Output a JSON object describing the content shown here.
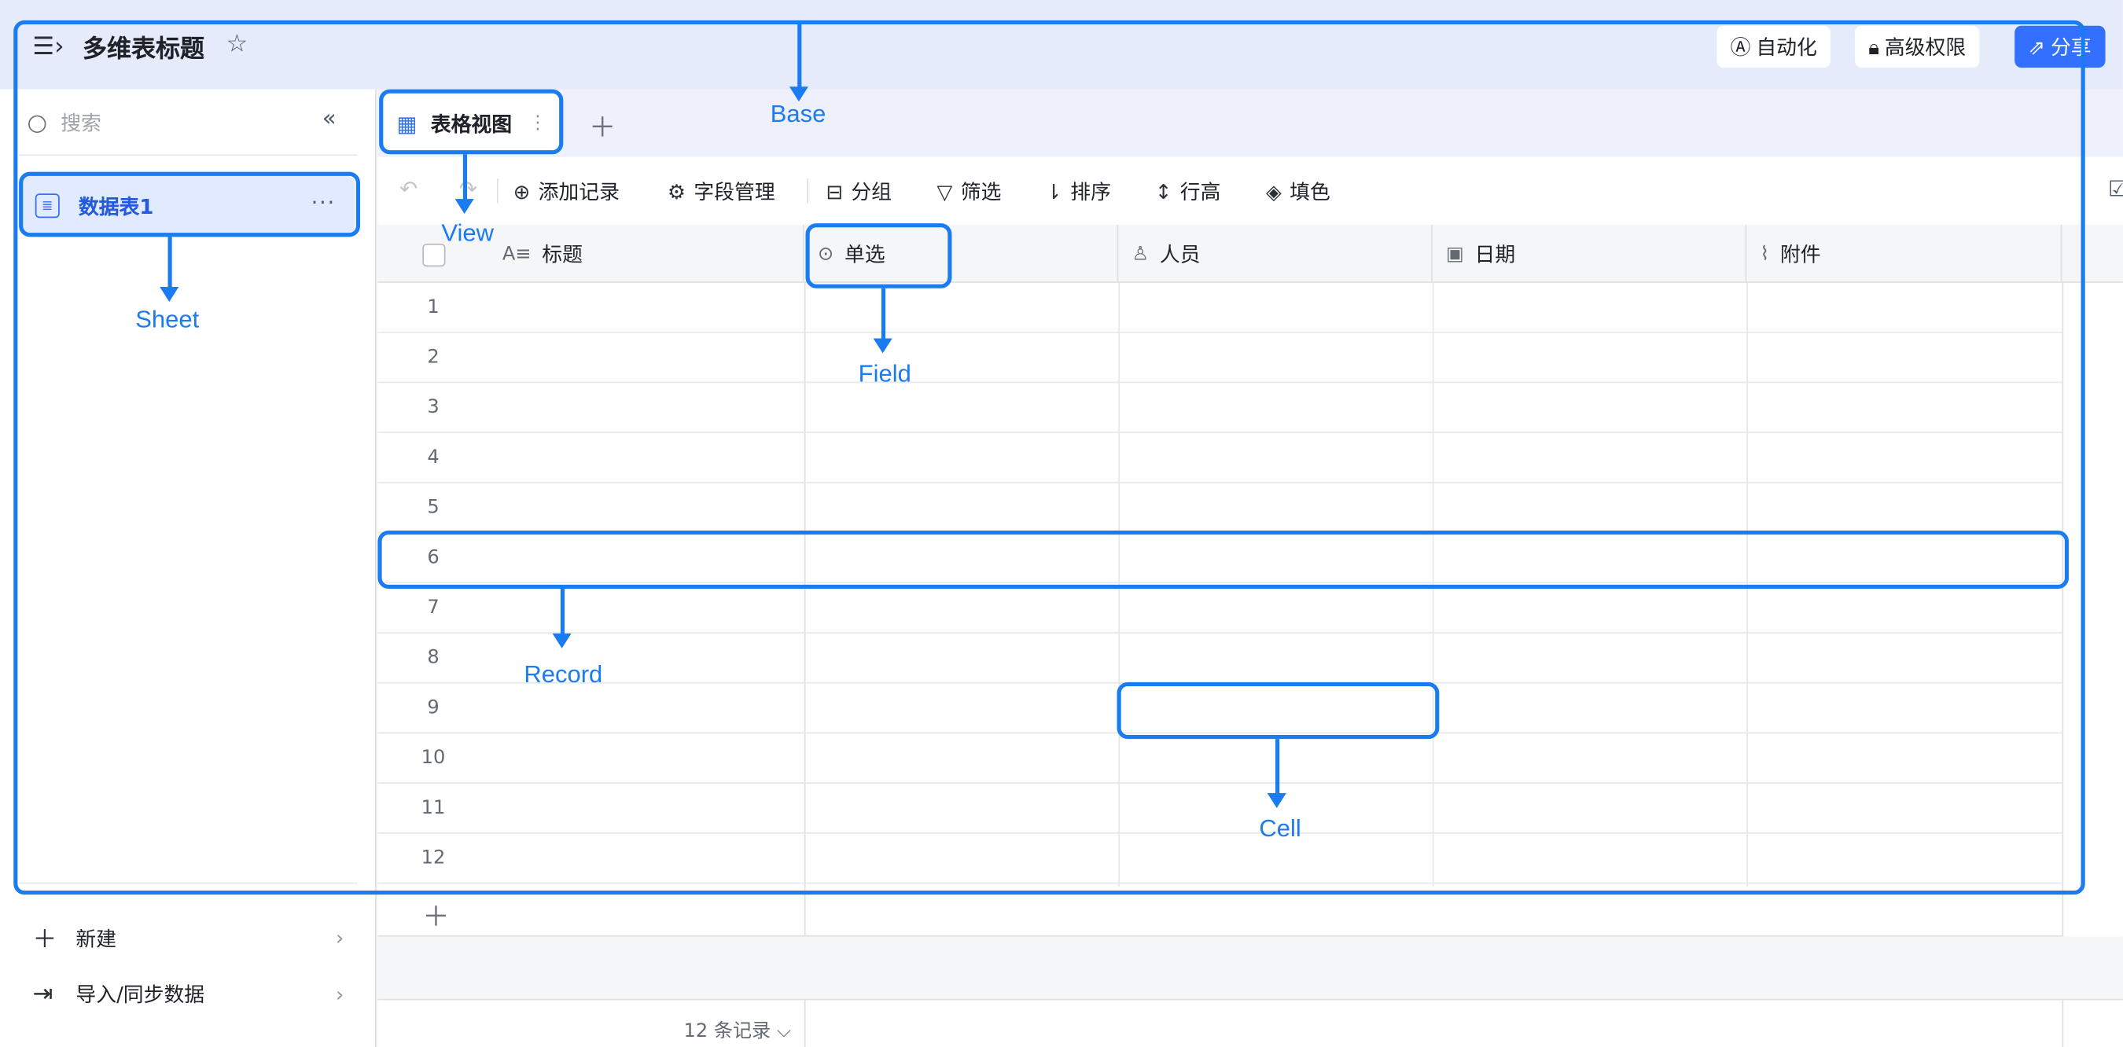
{
  "header": {
    "title": "多维表标题",
    "automation_label": "自动化",
    "permissions_label": "高级权限",
    "share_label": "分享"
  },
  "sidebar": {
    "search_placeholder": "搜索",
    "sheet_name": "数据表1",
    "new_label": "新建",
    "import_label": "导入/同步数据"
  },
  "view": {
    "tab_label": "表格视图"
  },
  "toolbar": {
    "add_record": "添加记录",
    "field_manage": "字段管理",
    "group": "分组",
    "filter": "筛选",
    "sort": "排序",
    "row_height": "行高",
    "fill_color": "填色"
  },
  "table": {
    "columns": [
      "标题",
      "单选",
      "人员",
      "日期",
      "附件"
    ],
    "row_numbers": [
      "1",
      "2",
      "3",
      "4",
      "5",
      "6",
      "7",
      "8",
      "9",
      "10",
      "11",
      "12"
    ],
    "record_count": "12 条记录"
  },
  "annotations": {
    "base": "Base",
    "view": "View",
    "sheet": "Sheet",
    "field": "Field",
    "record": "Record",
    "cell": "Cell"
  },
  "colors": {
    "accent": "#3370ff",
    "annotation": "#1a7cf0",
    "header_bg": "#e6ebfb"
  }
}
